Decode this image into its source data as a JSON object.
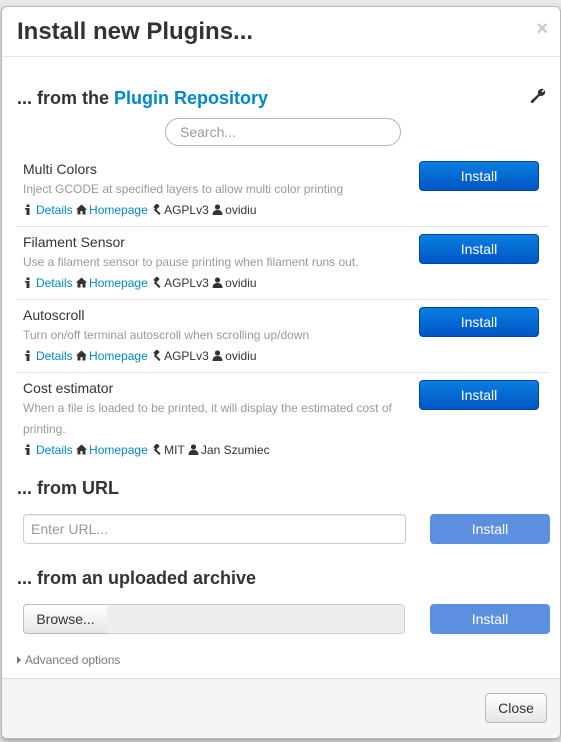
{
  "dialog": {
    "title": "Install new Plugins...",
    "close_glyph": "×"
  },
  "repository": {
    "heading_prefix": "... from the ",
    "heading_link": "Plugin Repository",
    "search_placeholder": "Search...",
    "plugins": [
      {
        "name": "Multi Colors",
        "description": "Inject GCODE at specified layers to allow multi color printing",
        "details": "Details",
        "homepage": "Homepage",
        "license": "AGPLv3",
        "author": "ovidiu",
        "install_label": "Install"
      },
      {
        "name": "Filament Sensor",
        "description": "Use a filament sensor to pause printing when filament runs out.",
        "details": "Details",
        "homepage": "Homepage",
        "license": "AGPLv3",
        "author": "ovidiu",
        "install_label": "Install"
      },
      {
        "name": "Autoscroll",
        "description": "Turn on/off terminal autoscroll when scrolling up/down",
        "details": "Details",
        "homepage": "Homepage",
        "license": "AGPLv3",
        "author": "ovidiu",
        "install_label": "Install"
      },
      {
        "name": "Cost estimator",
        "description": "When a file is loaded to be printed, it will display the estimated cost of printing.",
        "details": "Details",
        "homepage": "Homepage",
        "license": "MIT",
        "author": "Jan Szumiec",
        "install_label": "Install"
      }
    ]
  },
  "from_url": {
    "heading": "... from URL",
    "placeholder": "Enter URL...",
    "install_label": "Install"
  },
  "from_archive": {
    "heading": "... from an uploaded archive",
    "browse_label": "Browse...",
    "install_label": "Install"
  },
  "advanced": {
    "label": "Advanced options"
  },
  "footer": {
    "close_label": "Close"
  },
  "colors": {
    "link": "#0088cc",
    "install_primary": "#0055c5",
    "install_disabled": "#5d8fe0"
  }
}
